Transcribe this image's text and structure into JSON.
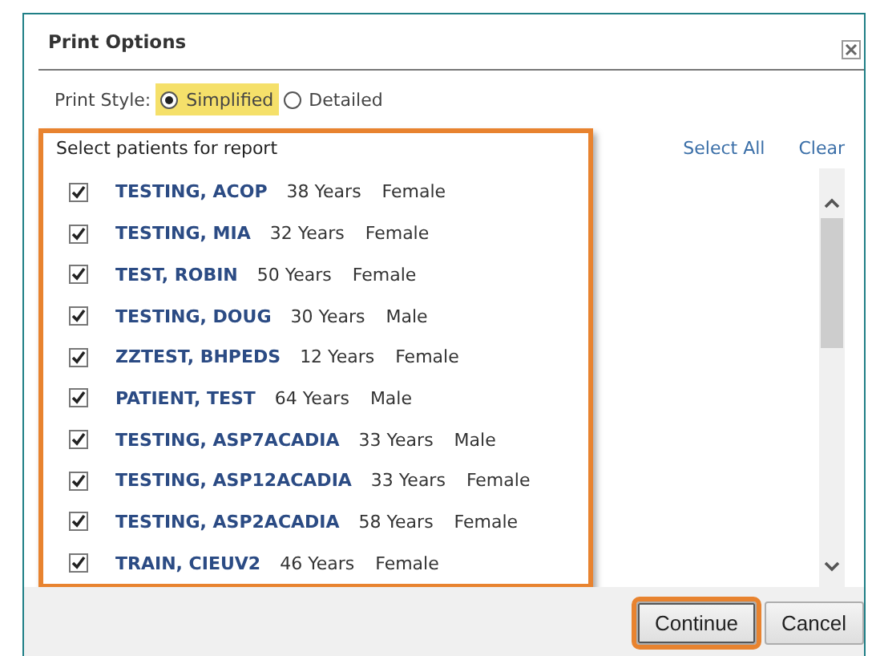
{
  "dialog": {
    "title": "Print Options"
  },
  "print_style": {
    "label": "Print Style:",
    "options": [
      {
        "label": "Simplified",
        "selected": true,
        "highlighted": true
      },
      {
        "label": "Detailed",
        "selected": false,
        "highlighted": false
      }
    ]
  },
  "patient_list": {
    "heading": "Select patients for report",
    "highlighted": true,
    "links": [
      "Select All",
      "Clear"
    ],
    "patients": [
      {
        "name": "TESTING, ACOP",
        "age": "38 Years",
        "sex": "Female",
        "checked": true
      },
      {
        "name": "TESTING, MIA",
        "age": "32 Years",
        "sex": "Female",
        "checked": true
      },
      {
        "name": "TEST, ROBIN",
        "age": "50 Years",
        "sex": "Female",
        "checked": true
      },
      {
        "name": "TESTING, DOUG",
        "age": "30 Years",
        "sex": "Male",
        "checked": true
      },
      {
        "name": "ZZTEST, BHPEDS",
        "age": "12 Years",
        "sex": "Female",
        "checked": true
      },
      {
        "name": "PATIENT, TEST",
        "age": "64 Years",
        "sex": "Male",
        "checked": true
      },
      {
        "name": "TESTING, ASP7ACADIA",
        "age": "33 Years",
        "sex": "Male",
        "checked": true
      },
      {
        "name": "TESTING, ASP12ACADIA",
        "age": "33 Years",
        "sex": "Female",
        "checked": true
      },
      {
        "name": "TESTING, ASP2ACADIA",
        "age": "58 Years",
        "sex": "Female",
        "checked": true
      },
      {
        "name": "TRAIN, CIEUV2",
        "age": "46 Years",
        "sex": "Female",
        "checked": true
      }
    ]
  },
  "buttons": [
    {
      "label": "Continue",
      "highlighted": true
    },
    {
      "label": "Cancel",
      "highlighted": false
    }
  ]
}
